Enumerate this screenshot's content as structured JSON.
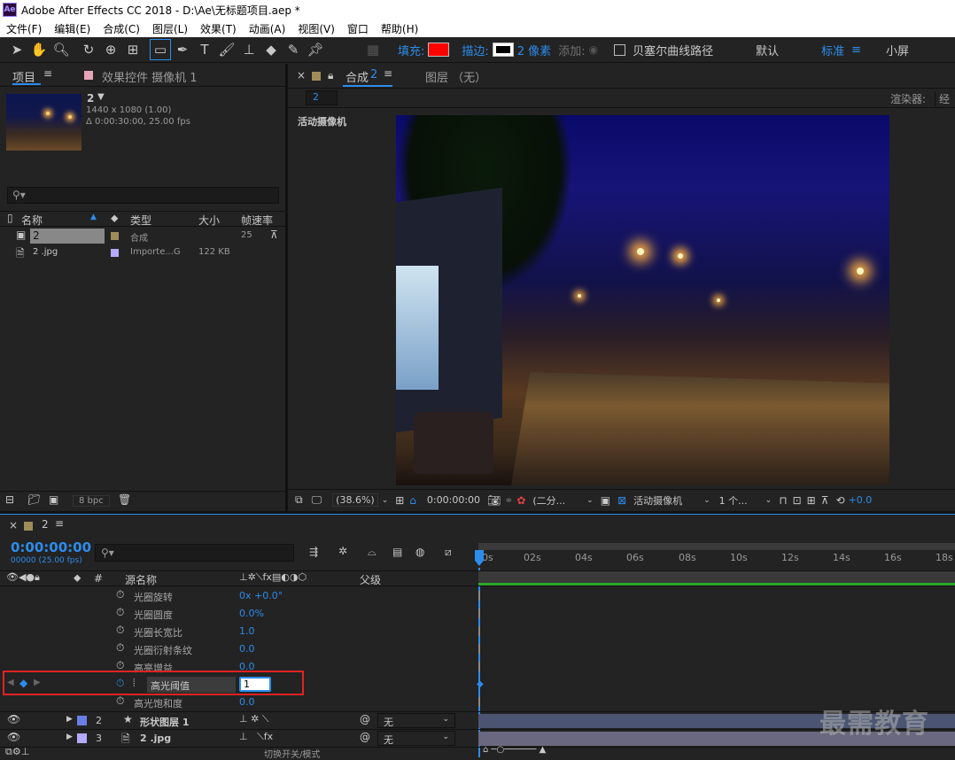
{
  "window": {
    "title": "Adobe After Effects CC 2018 - D:\\Ae\\无标题项目.aep *",
    "logo": "Ae"
  },
  "menu": [
    "文件(F)",
    "编辑(E)",
    "合成(C)",
    "图层(L)",
    "效果(T)",
    "动画(A)",
    "视图(V)",
    "窗口",
    "帮助(H)"
  ],
  "toolbar": {
    "fill_label": "填充:",
    "fill_color": "#ff0000",
    "stroke_label": "描边:",
    "stroke_px": "2 像素",
    "add_label": "添加:",
    "bezier_label": "贝塞尔曲线路径",
    "ws_default": "默认",
    "ws_standard": "标准",
    "ws_small": "小屏"
  },
  "project_panel": {
    "tab_project": "项目",
    "tab_effects": "效果控件 摄像机 1",
    "comp_name": "2",
    "comp_size": "1440 x 1080 (1.00)",
    "comp_duration": "Δ 0:00:30:00, 25.00 fps",
    "search_placeholder": "",
    "columns": {
      "name": "名称",
      "type": "类型",
      "size": "大小",
      "fps": "帧速率"
    },
    "items": [
      {
        "name": "2",
        "type": "合成",
        "size": "",
        "fps": "25",
        "color": "#a08c5a"
      },
      {
        "name": "2 .jpg",
        "type": "Importe...G",
        "size": "122 KB",
        "fps": "",
        "color": "#b4aaff"
      }
    ],
    "bpc": "8 bpc"
  },
  "comp_panel": {
    "tab_comp": "合成",
    "tab_comp_name": "2",
    "tab_layer": "图层 （无）",
    "crumb": "2",
    "renderer_label": "渲染器:",
    "renderer_value": "经",
    "active_camera": "活动摄像机",
    "zoom": "(38.6%)",
    "timecode": "0:00:00:00",
    "resolution": "(二分...",
    "view": "活动摄像机",
    "view_count": "1 个...",
    "exposure": "+0.0"
  },
  "timeline": {
    "comp_tab": "2",
    "timecode": "0:00:00:00",
    "timecode_sub": "00000 (25.00 fps)",
    "col_source": "源名称",
    "col_parent": "父级",
    "col_num": "#",
    "ticks": [
      "0s",
      "02s",
      "04s",
      "06s",
      "08s",
      "10s",
      "12s",
      "14s",
      "16s",
      "18s"
    ],
    "properties": [
      {
        "name": "光圈旋转",
        "value": "0x +0.0°"
      },
      {
        "name": "光圈圆度",
        "value": "0.0%"
      },
      {
        "name": "光圈长宽比",
        "value": "1.0"
      },
      {
        "name": "光圈衍射条纹",
        "value": "0.0"
      },
      {
        "name": "高亮增益",
        "value": "0.0"
      },
      {
        "name": "高光阈值",
        "value": "1"
      },
      {
        "name": "高光饱和度",
        "value": "0.0"
      }
    ],
    "layers": [
      {
        "num": "2",
        "name": "形状图层 1",
        "parent": "无",
        "color": "#6b7ee8",
        "star": "★"
      },
      {
        "num": "3",
        "name": "2 .jpg",
        "parent": "无",
        "color": "#b4aaff",
        "star": ""
      }
    ],
    "bottom_label": "切换开关/模式"
  },
  "watermark": "最需教育"
}
